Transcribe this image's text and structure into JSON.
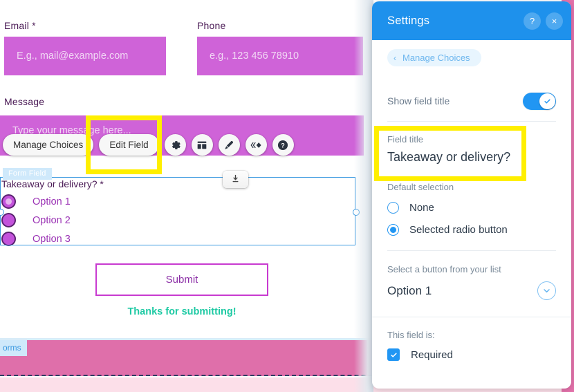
{
  "editor": {
    "fields": {
      "email": {
        "label": "Email *",
        "placeholder": "E.g., mail@example.com",
        "value": ""
      },
      "phone": {
        "label": "Phone",
        "placeholder": "e.g., 123 456 78910",
        "value": ""
      },
      "message": {
        "label": "Message",
        "placeholder": "Type your message here...",
        "value": ""
      }
    },
    "toolbar": {
      "manage_choices_label": "Manage Choices",
      "edit_field_label": "Edit Field",
      "icons": [
        "gear-icon",
        "layout-icon",
        "brush-icon",
        "animation-icon",
        "help-icon"
      ]
    },
    "selection": {
      "tag": "Form Field",
      "download_icon": "download-icon"
    },
    "radio_group": {
      "title": "Takeaway or delivery? *",
      "options": [
        {
          "label": "Option 1",
          "selected": true
        },
        {
          "label": "Option 2",
          "selected": false
        },
        {
          "label": "Option 3",
          "selected": false
        }
      ]
    },
    "submit_label": "Submit",
    "thanks_message": "Thanks for submitting!",
    "bottom_section_tag": "orms"
  },
  "panel": {
    "title": "Settings",
    "help_icon": "?",
    "close_icon": "×",
    "breadcrumb": {
      "label": "Manage Choices",
      "chevron": "‹"
    },
    "show_field_title": {
      "label": "Show field title",
      "enabled": true
    },
    "field_title": {
      "label": "Field title",
      "value": "Takeaway or delivery?"
    },
    "default_selection": {
      "label": "Default selection",
      "options": [
        {
          "label": "None",
          "selected": false
        },
        {
          "label": "Selected radio button",
          "selected": true
        }
      ]
    },
    "select_button": {
      "label": "Select a button from your list",
      "value": "Option 1",
      "chevron_icon": "chevron-down-icon"
    },
    "field_is": {
      "label": "This field is:",
      "required": {
        "label": "Required",
        "checked": true
      }
    }
  },
  "colors": {
    "panel_header": "#1e91ec",
    "accent_blue": "#2196f3",
    "field_magenta": "#cf63d8",
    "highlight_yellow": "#ffef00",
    "thanks_teal": "#1fcaa4",
    "bottom_pink": "#df6faa"
  }
}
